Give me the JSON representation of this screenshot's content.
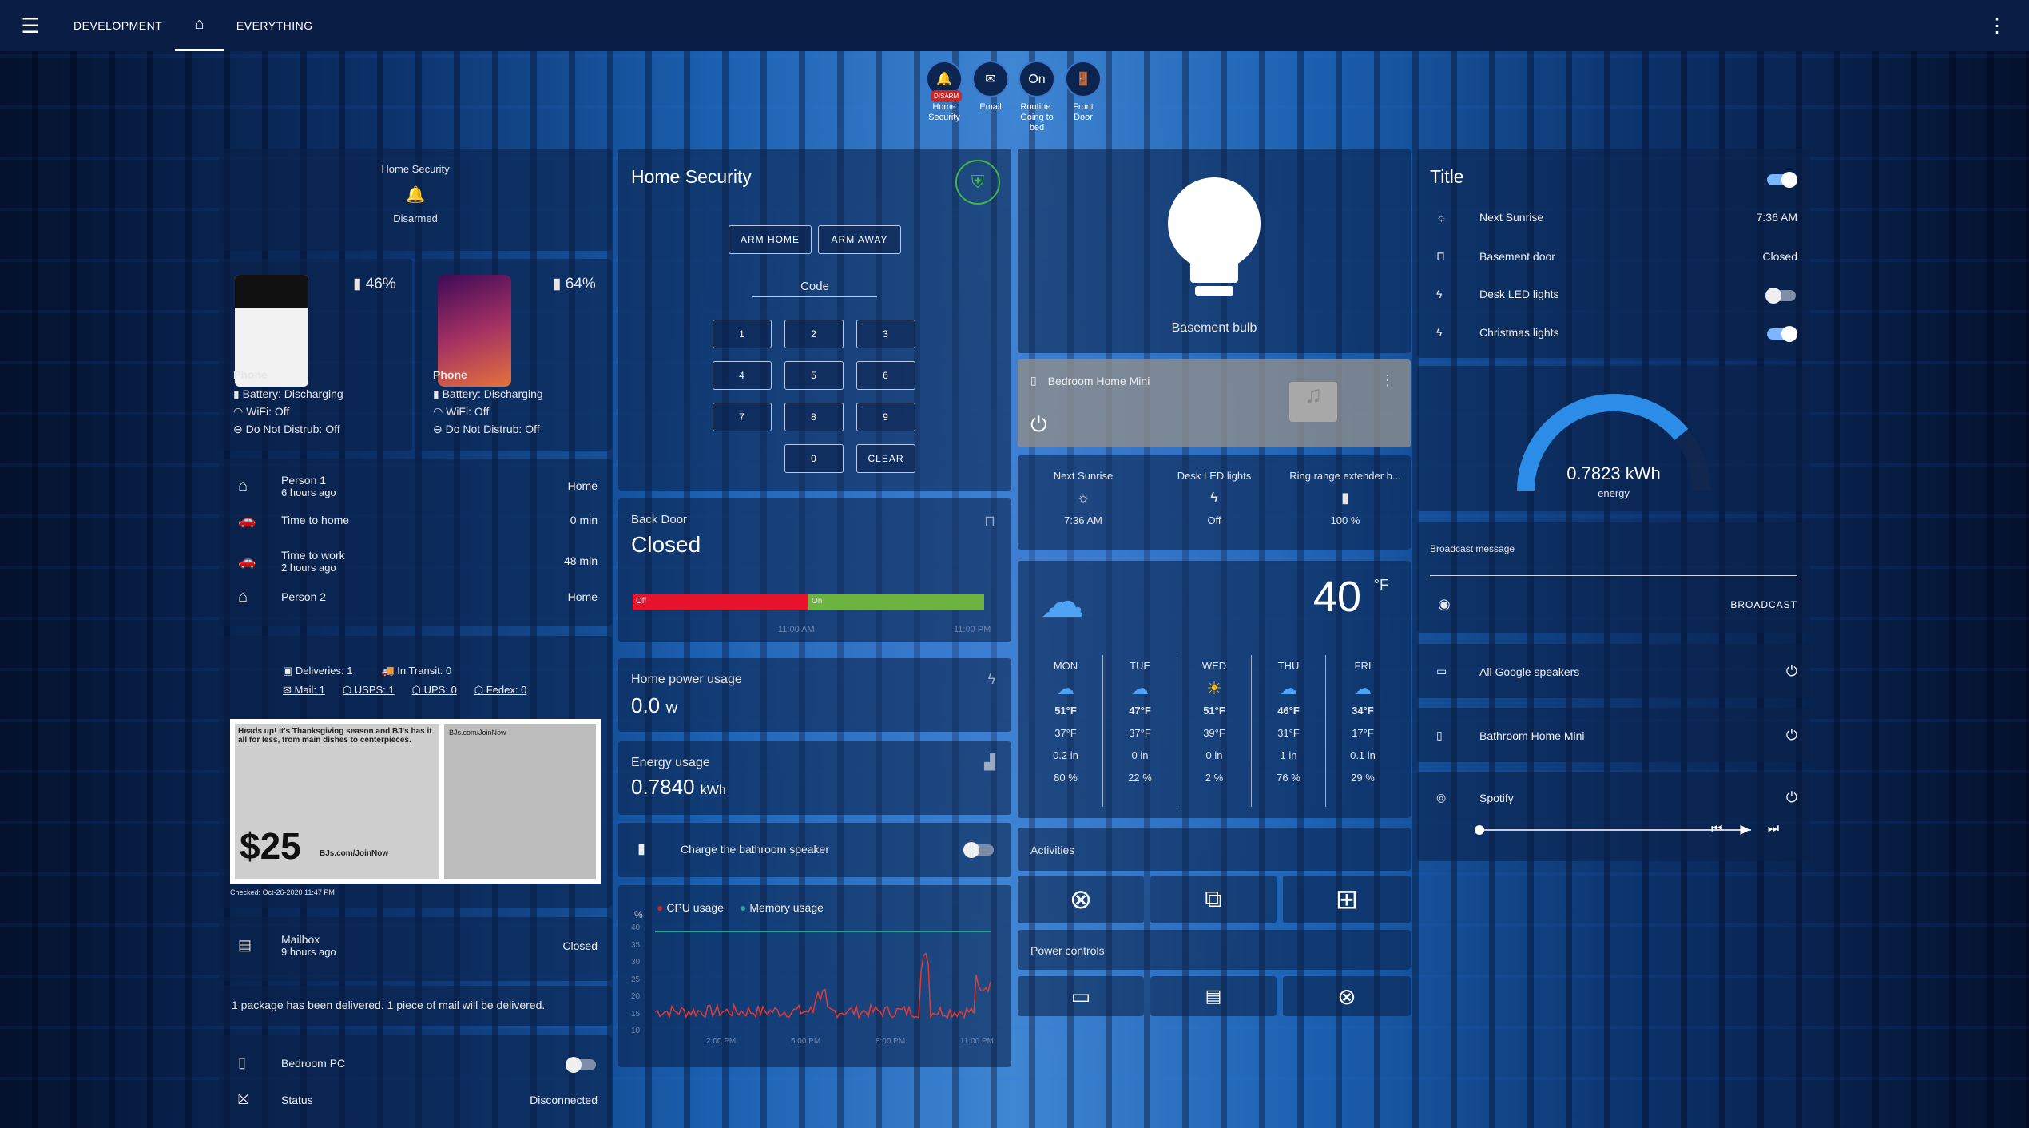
{
  "topbar": {
    "tabs": [
      "DEVELOPMENT",
      "EVERYTHING"
    ]
  },
  "badges": [
    {
      "icon": "bell-icon",
      "label": "Home Security",
      "tag": "DISARM"
    },
    {
      "icon": "email-icon",
      "label": "Email"
    },
    {
      "icon": "",
      "text": "On",
      "label": "Routine: Going to bed"
    },
    {
      "icon": "door-icon",
      "label": "Front Door"
    }
  ],
  "col1": {
    "security_title": "Home Security",
    "security_state": "Disarmed",
    "phones": [
      {
        "battery": "46%",
        "name": "Phone",
        "battery_state": "Battery: Discharging",
        "wifi": "WiFi: Off",
        "dnd": "Do Not Distrub: Off"
      },
      {
        "battery": "64%",
        "name": "Phone",
        "battery_state": "Battery: Discharging",
        "wifi": "WiFi: Off",
        "dnd": "Do Not Distrub: Off"
      }
    ],
    "people": [
      {
        "name": "Person 1",
        "sub": "6 hours ago",
        "value": "Home"
      },
      {
        "name": "Time to home",
        "sub": "",
        "value": "0 min"
      },
      {
        "name": "Time to work",
        "sub": "2 hours ago",
        "value": "48 min"
      },
      {
        "name": "Person 2",
        "sub": "",
        "value": "Home"
      }
    ],
    "deliveries": "Deliveries: 1",
    "in_transit": "In Transit: 0",
    "mail": "Mail: 1",
    "usps": "USPS: 1",
    "ups": "UPS: 0",
    "fedex": "Fedex: 0",
    "mail_heading": "Heads up! It's Thanksgiving season and BJ's has it all for less, from main dishes to centerpieces.",
    "mail_price": "$25",
    "mail_url": "BJs.com/JoinNow",
    "checked": "Checked: Oct-26-2020 11:47 PM",
    "mailbox_name": "Mailbox",
    "mailbox_sub": "9 hours ago",
    "mailbox_state": "Closed",
    "package_note": "1 package has been delivered. 1 piece of mail will be delivered.",
    "pc_name": "Bedroom PC",
    "status_name": "Status",
    "status_value": "Disconnected"
  },
  "col2": {
    "title": "Home Security",
    "arm_home": "ARM HOME",
    "arm_away": "ARM AWAY",
    "code_label": "Code",
    "keys": [
      "1",
      "2",
      "3",
      "4",
      "5",
      "6",
      "7",
      "8",
      "9",
      "0",
      "CLEAR"
    ],
    "door_name": "Back Door",
    "door_state": "Closed",
    "bar_off": "Off",
    "bar_on": "On",
    "t1": "11:00 AM",
    "t2": "11:00 PM",
    "power_name": "Home power usage",
    "power_value": "0.0",
    "power_unit": "W",
    "energy_name": "Energy usage",
    "energy_value": "0.7840",
    "energy_unit": "kWh",
    "charge_label": "Charge the bathroom speaker",
    "cpu_label": "CPU usage",
    "mem_label": "Memory usage",
    "y_unit": "%",
    "y_ticks": [
      "40",
      "35",
      "30",
      "25",
      "20",
      "15",
      "10"
    ],
    "x_ticks": [
      "2:00 PM",
      "5:00 PM",
      "8:00 PM",
      "11:00 PM"
    ]
  },
  "col3": {
    "bulb_name": "Basement bulb",
    "media_name": "Bedroom Home Mini",
    "glance": [
      {
        "name": "Next Sunrise",
        "value": "7:36 AM"
      },
      {
        "name": "Desk LED lights",
        "value": "Off"
      },
      {
        "name": "Ring range extender b...",
        "value": "100 %"
      }
    ],
    "temp": "40",
    "temp_unit": "°F",
    "forecast": [
      {
        "day": "MON",
        "hi": "51°F",
        "lo": "37°F",
        "precip": "0.2 in",
        "pct": "80 %"
      },
      {
        "day": "TUE",
        "hi": "47°F",
        "lo": "37°F",
        "precip": "0 in",
        "pct": "22 %"
      },
      {
        "day": "WED",
        "hi": "51°F",
        "lo": "39°F",
        "precip": "0 in",
        "pct": "2 %"
      },
      {
        "day": "THU",
        "hi": "46°F",
        "lo": "31°F",
        "precip": "1 in",
        "pct": "76 %"
      },
      {
        "day": "FRI",
        "hi": "34°F",
        "lo": "17°F",
        "precip": "0.1 in",
        "pct": "29 %"
      }
    ],
    "activities": "Activities",
    "power_controls": "Power controls"
  },
  "col4": {
    "title": "Title",
    "entities": [
      {
        "name": "Next Sunrise",
        "value": "7:36 AM"
      },
      {
        "name": "Basement door",
        "value": "Closed"
      },
      {
        "name": "Desk LED lights",
        "value": ""
      },
      {
        "name": "Christmas lights",
        "value": ""
      }
    ],
    "gauge_value": "0.7823 kWh",
    "gauge_label": "energy",
    "gauge_level": 0.78,
    "broadcast_label": "Broadcast message",
    "broadcast_btn": "BROADCAST",
    "speakers": "All Google speakers",
    "bathroom": "Bathroom Home Mini",
    "spotify": "Spotify"
  },
  "colors": {
    "accent": "#7cb6ff",
    "red": "#e8142c",
    "green": "#6db33f",
    "gauge": "#2b8de8"
  }
}
